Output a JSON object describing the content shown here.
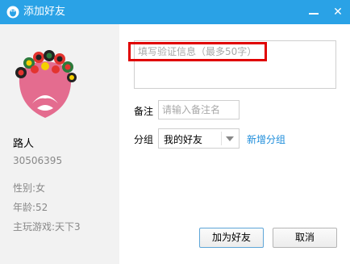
{
  "window": {
    "title": "添加好友",
    "minimize_glyph": "",
    "close_glyph": "✕"
  },
  "profile": {
    "name": "路人",
    "qq_number": "30506395",
    "gender": "性别:女",
    "age": "年龄:52",
    "main_game": "主玩游戏:天下3"
  },
  "form": {
    "verify_placeholder": "填写验证信息（最多50字）",
    "remark_label": "备注",
    "remark_placeholder": "请输入备注名",
    "group_label": "分组",
    "group_value": "我的好友",
    "new_group_link": "新增分组"
  },
  "buttons": {
    "add": "加为好友",
    "cancel": "取消"
  },
  "colors": {
    "titlebar": "#2aa2e6",
    "highlight": "#e00000",
    "link": "#1d8ddb"
  },
  "icons": {
    "app": "qq-penguin-icon",
    "avatar": "peking-opera-mask-avatar"
  }
}
